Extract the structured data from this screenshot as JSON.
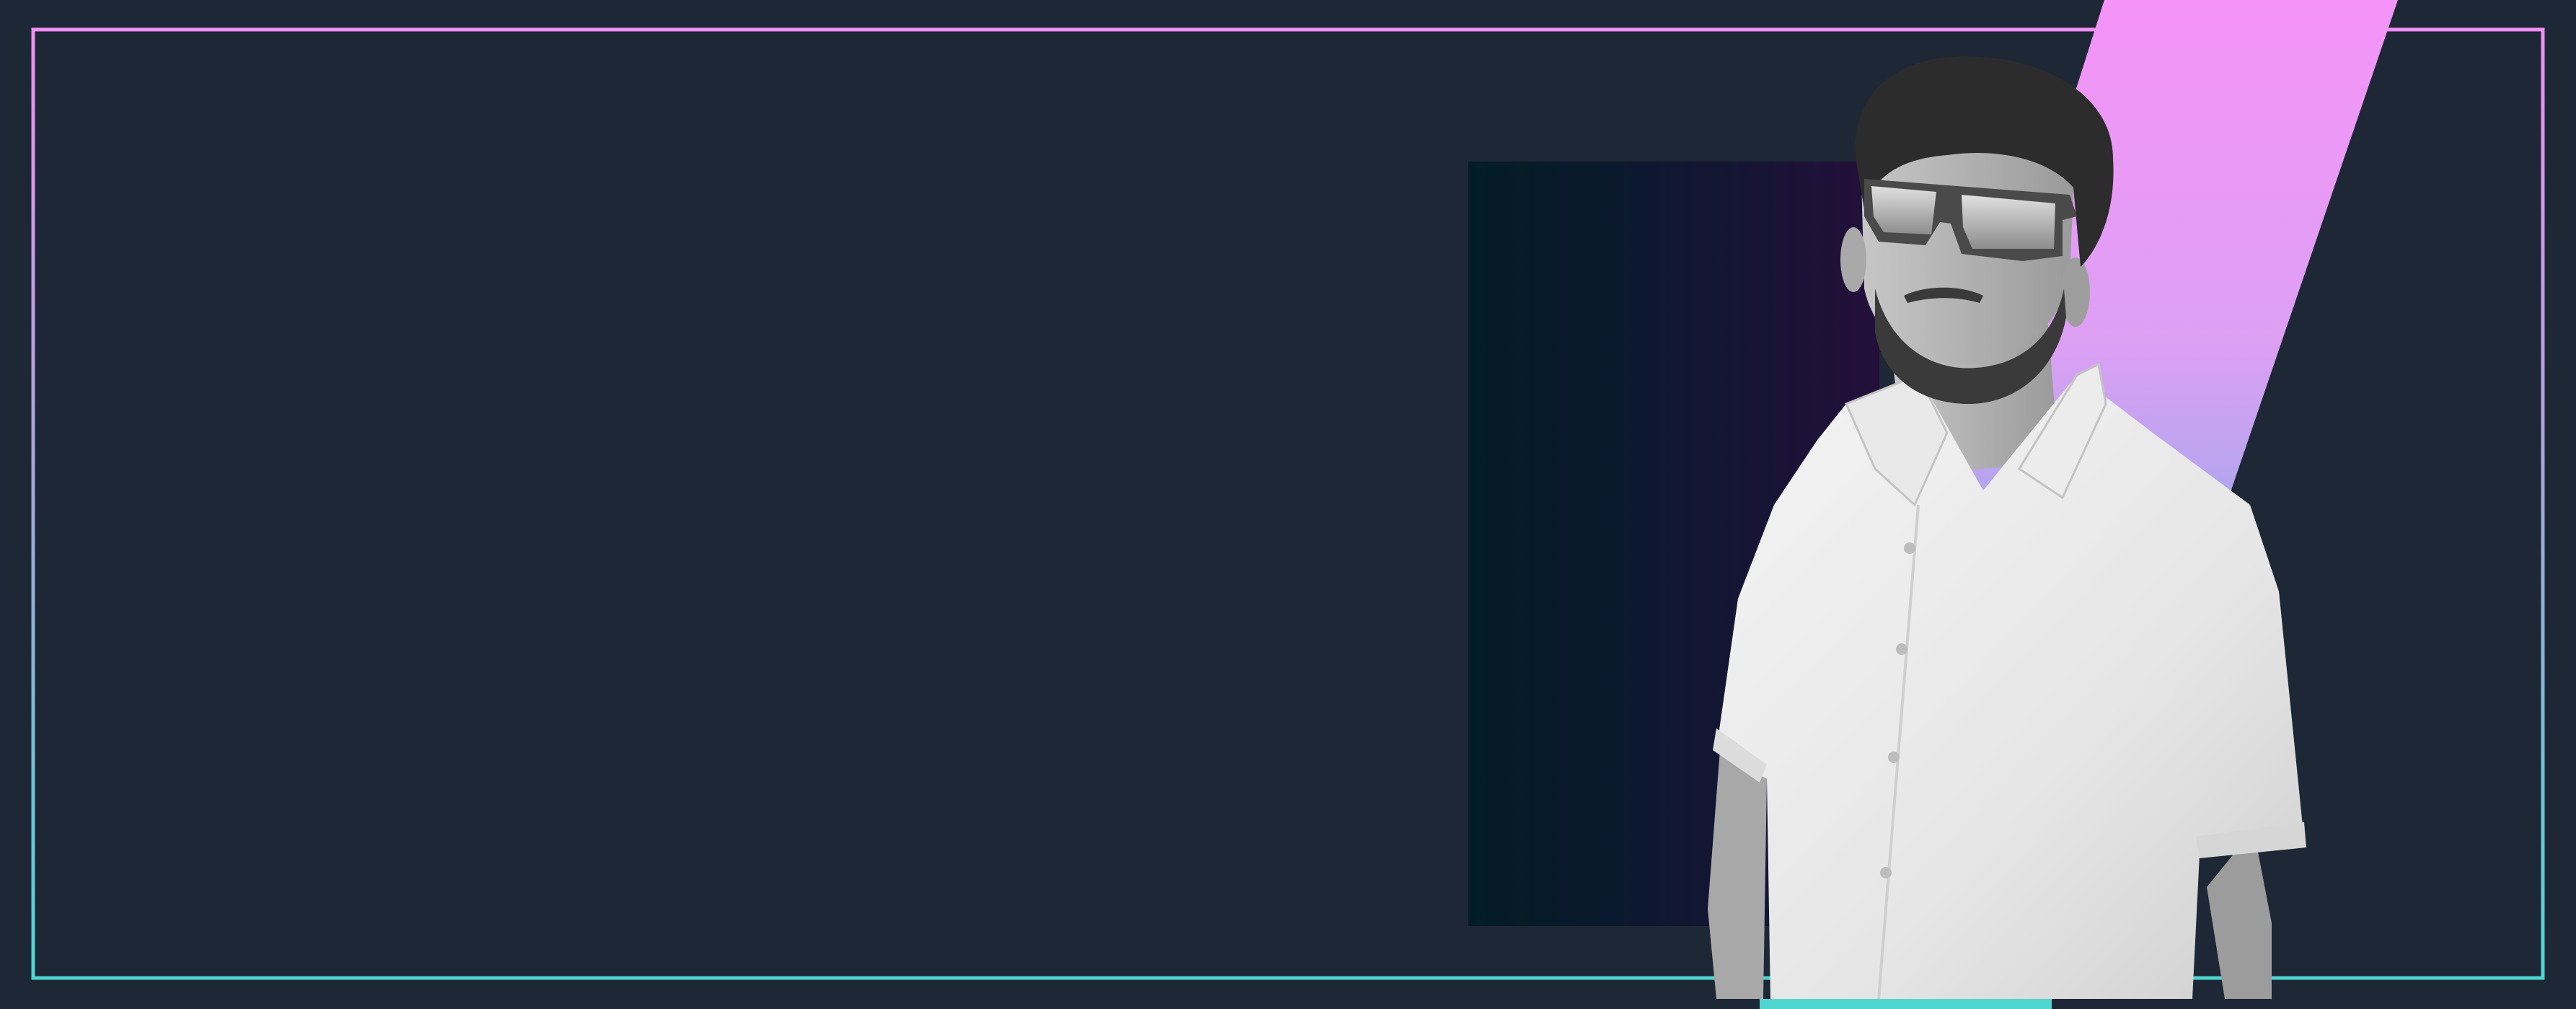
{
  "banner": {
    "colors": {
      "background": "#1e2735",
      "frame_top": "#f08ff5",
      "frame_bottom": "#4fd6d1",
      "stripe_top": "#f593f8",
      "stripe_bottom": "#b3a5ef",
      "panel_left": "#031d26",
      "panel_right": "#230f3a",
      "shirt": "#f2f2f2",
      "hair": "#2c2c2c",
      "skin": "#b8b8b8"
    },
    "portrait": {
      "icon": "person-photo-icon",
      "subject": "man-wearing-sunglasses-and-white-shirt"
    }
  }
}
